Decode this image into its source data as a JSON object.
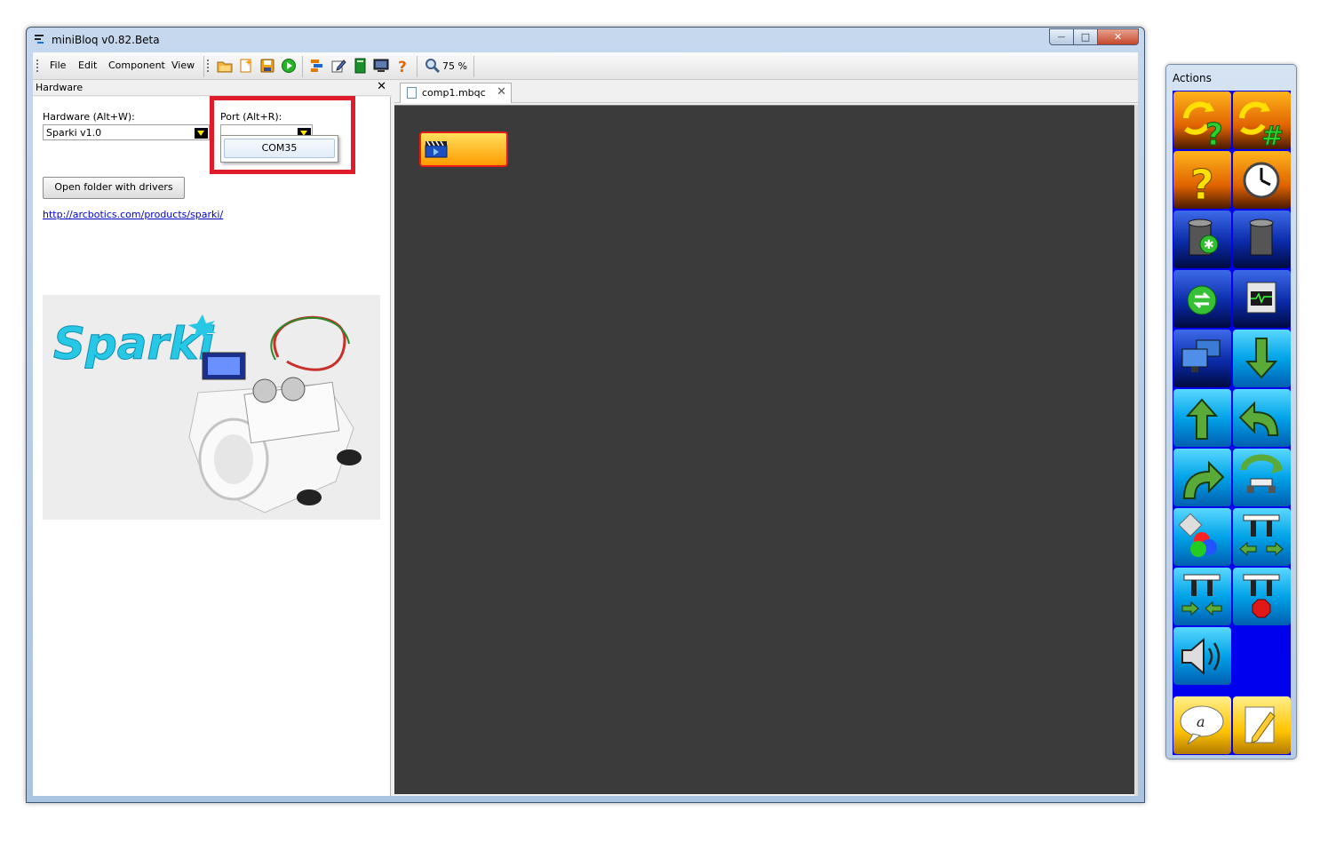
{
  "window": {
    "title": "miniBloq v0.82.Beta",
    "controls": {
      "minimize": "—",
      "maximize": "□",
      "close": "✕"
    }
  },
  "menu": {
    "items": [
      "File",
      "Edit",
      "Component",
      "View"
    ]
  },
  "toolbar": {
    "icons": [
      "open-folder-icon",
      "new-file-icon",
      "save-icon",
      "run-icon",
      "blocks-icon",
      "edit-icon",
      "book-icon",
      "terminal-icon",
      "help-icon"
    ],
    "zoom_label": "75 %"
  },
  "hardware_panel": {
    "title": "Hardware",
    "close": "✕",
    "hardware_label": "Hardware (Alt+W):",
    "hardware_value": "Sparki v1.0",
    "port_label": "Port (Alt+R):",
    "port_value": "",
    "port_options": [
      "COM35"
    ],
    "drivers_button": "Open folder with drivers",
    "link": "http://arcbotics.com/products/sparki/",
    "image_logo": "Sparki"
  },
  "editor": {
    "tab_name": "comp1.mbqc",
    "tab_close": "✕",
    "canvas_color": "#3b3b3b"
  },
  "actions": {
    "title": "Actions",
    "tiles": [
      "sync-question-icon",
      "sync-hash-icon",
      "question-icon",
      "clock-icon",
      "add-variable-icon",
      "trash-variable-icon",
      "exchange-icon",
      "oscilloscope-icon",
      "monitors-icon",
      "arrow-down-icon",
      "arrow-up-icon",
      "turn-left-icon",
      "turn-right-icon",
      "rotate-icon",
      "color-sensor-icon",
      "gripper-open-icon",
      "gripper-close-icon",
      "gripper-stop-icon",
      "speaker-icon",
      "empty",
      "comment-icon",
      "note-icon"
    ]
  },
  "colors": {
    "highlight": "#e01b2a",
    "block_fill": "#ffb000",
    "actions_bg": "#0000ee"
  }
}
